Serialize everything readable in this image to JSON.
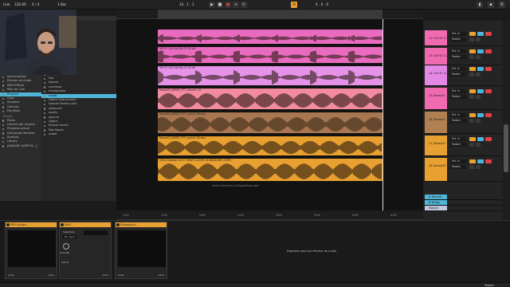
{
  "transport": {
    "tempo": "120.00",
    "time_sig": "4 / 4",
    "bar": "1 Bar",
    "position": "33 . 1 . 1",
    "end": "4 . 0 . 0"
  },
  "browser": {
    "header": "Nombre",
    "categories": [
      {
        "label": "Instrumentos",
        "icon": "instrument-icon"
      },
      {
        "label": "Efectos de Audio",
        "icon": "audio-fx-icon"
      },
      {
        "label": "MIDI Effects",
        "icon": "midi-fx-icon"
      },
      {
        "label": "Max for Live",
        "icon": "m4l-icon"
      },
      {
        "label": "Plug-Ins",
        "icon": "plugin-icon",
        "selected": true
      },
      {
        "label": "Clips",
        "icon": "clip-icon"
      },
      {
        "label": "Samples",
        "icon": "sample-icon"
      },
      {
        "label": "Grooves",
        "icon": "groove-icon"
      },
      {
        "label": "Plantillas",
        "icon": "template-icon"
      }
    ],
    "places_header": "Places",
    "places": [
      {
        "label": "Packs"
      },
      {
        "label": "Librería del usuario"
      },
      {
        "label": "Proyecto actual"
      },
      {
        "label": "Descargas librerías"
      },
      {
        "label": "Armillas"
      },
      {
        "label": "Library"
      },
      {
        "label": "[ANADIR CARPETA...]"
      }
    ],
    "items": [
      "bluecafe",
      "Bluecafe2",
      "bluecafe",
      "Catálogos",
      "drums",
      "done3",
      "escher",
      "FabFilter",
      "Flux",
      "genesis",
      "guitar",
      "iZotope",
      "jbridge",
      "kits",
      "legend",
      "Loudmax",
      "manipulator",
      "meda",
      "Native Instruments",
      "Nomad Factory x64",
      "oldsound",
      "oscelv",
      "oxound",
      "Lógica",
      "Reveal Sound",
      "Rob Papen",
      "scaler"
    ],
    "selected_item": "meda"
  },
  "ruler": {
    "marks": [
      "1:00",
      "1:30",
      "2:00",
      "2:30",
      "3:00",
      "3:30",
      "4:00",
      "4:30"
    ]
  },
  "tracks": [
    {
      "name": "12 Out 67 3.2",
      "color": "#f06ab0",
      "clip_color": "#e86bc0",
      "clip_name": "",
      "io": "Ext. In",
      "out": "Master"
    },
    {
      "name": "13 Out 67 3.3",
      "color": "#f06ab0",
      "clip_color": "#e86bc0",
      "clip_name": "VIP 07 124 Hzl Eby F3 32 bit",
      "io": "Ext. In",
      "out": "Master"
    },
    {
      "name": "14 Out 67 3.4",
      "color": "#e488e6",
      "clip_color": "#e592e8",
      "clip_name": "VIP 07 124 Hzl Eby F3 32 bit",
      "io": "Ext. In",
      "out": "Master"
    },
    {
      "name": "15 Demo01",
      "color": "#f06ab0",
      "clip_color": "#f28aa0",
      "clip_name": "Demo03_SDRET_PTT_Voice01 16",
      "io": "Ext. In",
      "out": "Master"
    },
    {
      "name": "16 Demo01",
      "color": "#b08050",
      "clip_color": "#a87650",
      "clip_name": "Demo03_SDRET_PTT_synth2 08 wav",
      "io": "Ext. In",
      "out": "Master"
    },
    {
      "name": "17 Demo02",
      "color": "#e8a030",
      "clip_color": "#e8a030",
      "clip_name": "Demo03_SDRET_PTT_synth2 08 wav",
      "io": "Ext. In",
      "out": "Master"
    },
    {
      "name": "18 Demo03",
      "color": "#e8a030",
      "clip_color": "#e8a030",
      "clip_name": "Unity Subbass full 17 BEATS LOOPS 1B BASSLINE LOOPS",
      "io": "Ext. In",
      "out": "Master"
    }
  ],
  "arrange_drop_hint": "Suelte Archivos y Dispositivos aquí",
  "returns": [
    {
      "name": "A Reverb",
      "color": "#4fb5d6"
    },
    {
      "name": "B Delay",
      "color": "#4fb5d6"
    },
    {
      "name": "Master",
      "color": "#c0c8e0"
    }
  ],
  "devices": [
    {
      "title": "PRO Analyz...",
      "footer_left": "none",
      "footer_right": "none"
    },
    {
      "title": "ENVI",
      "footer_left": "Sidechain",
      "footer_mid": "No Input",
      "gain": "0.00 dB",
      "dry": "100 %",
      "footer_right": "none"
    },
    {
      "title": "Ultrasound...",
      "footer_left": "none",
      "footer_right": "none"
    }
  ],
  "device_drop_hint": "Deposite aquí los efectos de audio",
  "status": {
    "right": "Master"
  },
  "colors": {
    "accent": "#e8a030",
    "selection": "#4fb5d6",
    "pink": "#f06ab0"
  }
}
